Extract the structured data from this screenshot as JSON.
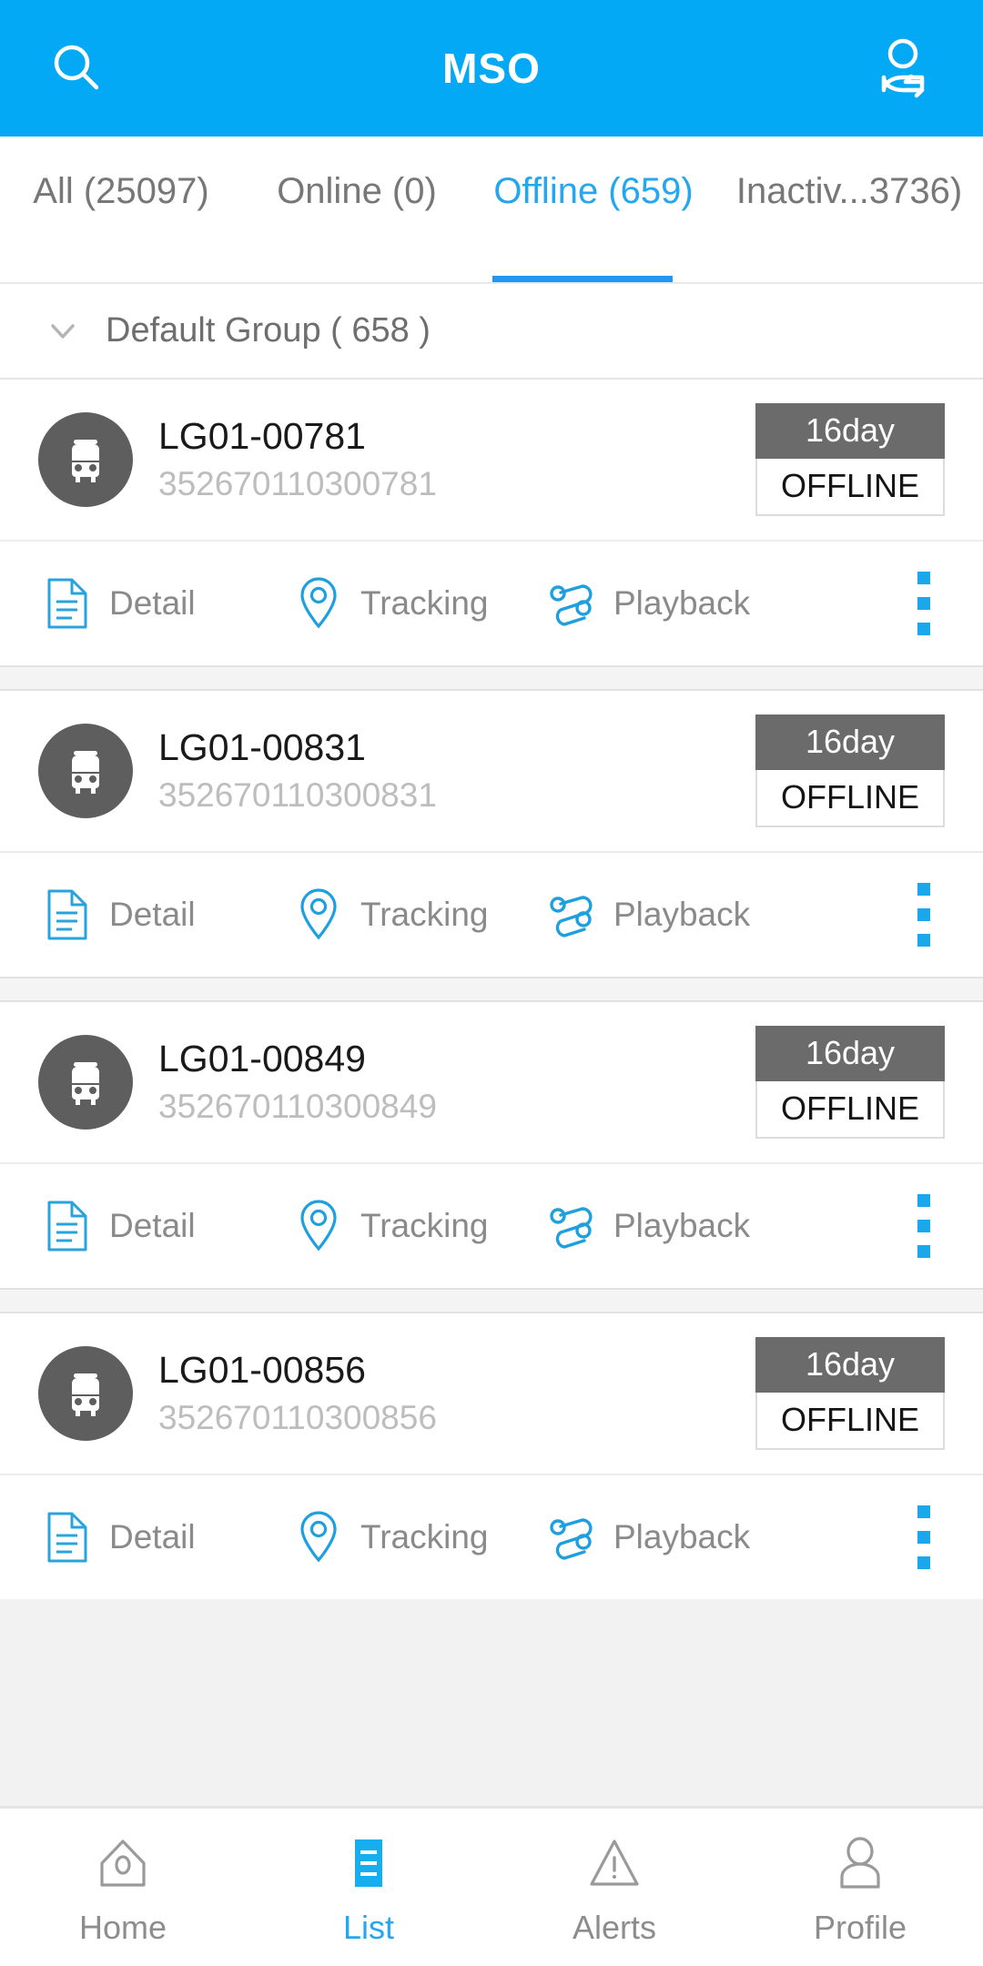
{
  "header": {
    "title": "MSO",
    "search_icon": "search-icon",
    "user_switch_icon": "switch-user-icon",
    "background_color": "#03A9F4"
  },
  "tabs": {
    "active_index": 2,
    "accent_color": "#22A7F0",
    "items": [
      {
        "label": "All (25097)"
      },
      {
        "label": "Online (0)"
      },
      {
        "label": "Offline (659)"
      },
      {
        "label": "Inactiv...3736)"
      }
    ]
  },
  "group": {
    "chevron_icon": "chevron-down-icon",
    "label": "Default Group ( 658 )"
  },
  "actions": {
    "detail": {
      "label": "Detail",
      "icon": "document-icon"
    },
    "tracking": {
      "label": "Tracking",
      "icon": "map-pin-icon"
    },
    "playback": {
      "label": "Playback",
      "icon": "route-path-icon"
    },
    "more": {
      "icon": "kebab-menu-icon"
    }
  },
  "devices": [
    {
      "name": "LG01-00781",
      "imei": "352670110300781",
      "days": "16day",
      "status": "OFFLINE",
      "avatar_icon": "bus-icon"
    },
    {
      "name": "LG01-00831",
      "imei": "352670110300831",
      "days": "16day",
      "status": "OFFLINE",
      "avatar_icon": "bus-icon"
    },
    {
      "name": "LG01-00849",
      "imei": "352670110300849",
      "days": "16day",
      "status": "OFFLINE",
      "avatar_icon": "bus-icon"
    },
    {
      "name": "LG01-00856",
      "imei": "352670110300856",
      "days": "16day",
      "status": "OFFLINE",
      "avatar_icon": "bus-icon"
    }
  ],
  "bottom_nav": {
    "active_index": 1,
    "items": [
      {
        "label": "Home",
        "icon": "home-icon"
      },
      {
        "label": "List",
        "icon": "list-icon"
      },
      {
        "label": "Alerts",
        "icon": "warning-triangle-icon"
      },
      {
        "label": "Profile",
        "icon": "person-icon"
      }
    ]
  },
  "colors": {
    "brand_blue": "#03A9F4",
    "accent_blue": "#22A7F0",
    "badge_dark": "#6b6b6b",
    "avatar_gray": "#5e5e5e"
  }
}
